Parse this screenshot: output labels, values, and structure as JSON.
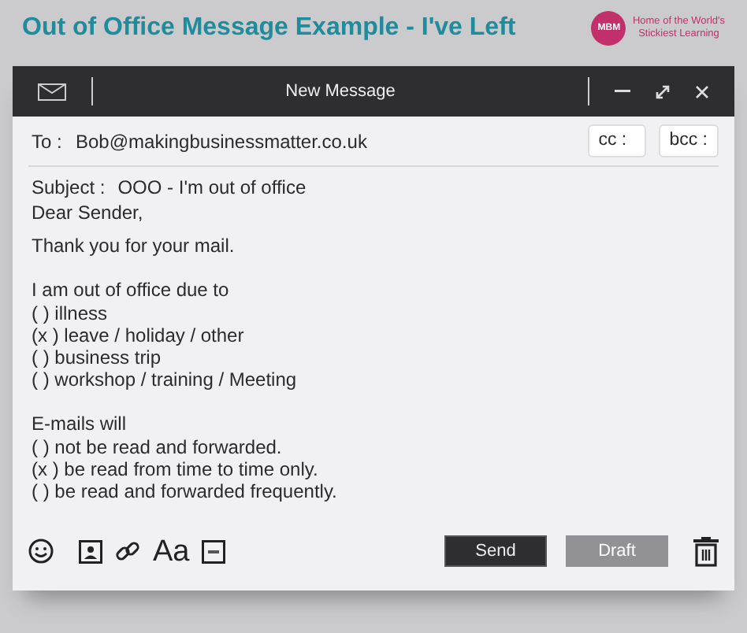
{
  "page_title": "Out of Office Message Example - I've Left",
  "logo": {
    "badge": "MBM",
    "tagline": [
      "Home of the World's",
      "Stickiest Learning"
    ]
  },
  "window": {
    "title": "New Message"
  },
  "to": {
    "label": "To :",
    "value": "Bob@makingbusinessmatter.co.uk",
    "cc": "cc :",
    "bcc": "bcc :"
  },
  "subject": {
    "label": "Subject :",
    "value": "OOO - I'm out of office"
  },
  "body": [
    [
      "Dear Sender,"
    ],
    [
      "Thank you for your mail."
    ],
    [
      "I am out of office due to",
      "( ) illness",
      "(x ) leave / holiday / other",
      "( ) business trip",
      "( ) workshop / training / Meeting"
    ],
    [
      "E-mails will",
      "( ) not be read and forwarded.",
      "(x ) be read from time to time only.",
      "( ) be read and forwarded frequently."
    ]
  ],
  "toolbar": {
    "format_label": "Aa"
  },
  "buttons": [
    {
      "label": "Send",
      "kind": "primary"
    },
    {
      "label": "Draft",
      "kind": "secondary"
    }
  ]
}
